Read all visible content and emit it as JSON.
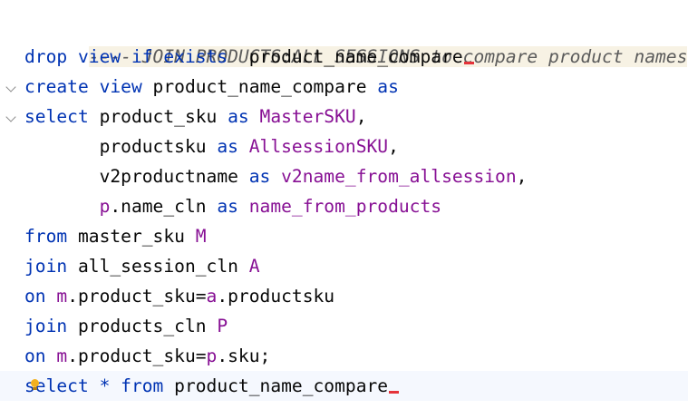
{
  "editor": {
    "lines": [
      {
        "tokens": [
          {
            "t": "comment",
            "v": "---- JOIN PRODUCTS:ALL_SESSIONS to compare product names"
          }
        ]
      },
      {
        "tokens": [
          {
            "t": "kw",
            "v": "drop view if exists"
          },
          {
            "t": "plain",
            "v": "  product_name_compare"
          }
        ]
      },
      {
        "tokens": [
          {
            "t": "kw",
            "v": "create view"
          },
          {
            "t": "plain",
            "v": " product_name_compare "
          },
          {
            "t": "kw",
            "v": "as"
          }
        ]
      },
      {
        "tokens": [
          {
            "t": "kw",
            "v": "select"
          },
          {
            "t": "plain",
            "v": " product_sku "
          },
          {
            "t": "kw",
            "v": "as"
          },
          {
            "t": "plain",
            "v": " "
          },
          {
            "t": "alias",
            "v": "MasterSKU"
          },
          {
            "t": "plain",
            "v": ","
          }
        ]
      },
      {
        "tokens": [
          {
            "t": "plain",
            "v": "       productsku "
          },
          {
            "t": "kw",
            "v": "as"
          },
          {
            "t": "plain",
            "v": " "
          },
          {
            "t": "alias",
            "v": "AllsessionSKU"
          },
          {
            "t": "plain",
            "v": ","
          }
        ]
      },
      {
        "tokens": [
          {
            "t": "plain",
            "v": "       v2productname "
          },
          {
            "t": "kw",
            "v": "as"
          },
          {
            "t": "plain",
            "v": " "
          },
          {
            "t": "alias",
            "v": "v2name_from_allsession"
          },
          {
            "t": "plain",
            "v": ","
          }
        ]
      },
      {
        "tokens": [
          {
            "t": "plain",
            "v": "       "
          },
          {
            "t": "alias",
            "v": "p"
          },
          {
            "t": "plain",
            "v": ".name_cln "
          },
          {
            "t": "kw",
            "v": "as"
          },
          {
            "t": "plain",
            "v": " "
          },
          {
            "t": "alias",
            "v": "name_from_products"
          }
        ]
      },
      {
        "tokens": [
          {
            "t": "kw",
            "v": "from"
          },
          {
            "t": "plain",
            "v": " master_sku "
          },
          {
            "t": "alias",
            "v": "M"
          }
        ]
      },
      {
        "tokens": [
          {
            "t": "kw",
            "v": "join"
          },
          {
            "t": "plain",
            "v": " all_session_cln "
          },
          {
            "t": "alias",
            "v": "A"
          }
        ]
      },
      {
        "tokens": [
          {
            "t": "kw",
            "v": "on"
          },
          {
            "t": "plain",
            "v": " "
          },
          {
            "t": "alias",
            "v": "m"
          },
          {
            "t": "plain",
            "v": ".product_sku="
          },
          {
            "t": "alias",
            "v": "a"
          },
          {
            "t": "plain",
            "v": ".productsku"
          }
        ]
      },
      {
        "tokens": [
          {
            "t": "kw",
            "v": "join"
          },
          {
            "t": "plain",
            "v": " products_cln "
          },
          {
            "t": "alias",
            "v": "P"
          }
        ]
      },
      {
        "tokens": [
          {
            "t": "kw",
            "v": "on"
          },
          {
            "t": "plain",
            "v": " "
          },
          {
            "t": "alias",
            "v": "m"
          },
          {
            "t": "plain",
            "v": ".product_sku="
          },
          {
            "t": "alias",
            "v": "p"
          },
          {
            "t": "plain",
            "v": ".sku;"
          }
        ]
      },
      {
        "tokens": [
          {
            "t": "kw",
            "v": "select"
          },
          {
            "t": "plain",
            "v": " "
          },
          {
            "t": "kw",
            "v": "*"
          },
          {
            "t": "plain",
            "v": " "
          },
          {
            "t": "kw",
            "v": "from"
          },
          {
            "t": "plain",
            "v": " product_name_compare"
          }
        ]
      }
    ],
    "fold_marker_lines": [
      2,
      3
    ],
    "error_marker_lines": [
      1,
      12
    ],
    "current_line": 12,
    "intention_icon": "lightbulb-icon",
    "colors": {
      "keyword": "#0033b3",
      "alias": "#871094",
      "comment": "#5b5b5b",
      "text": "#080808",
      "error": "#e5333a",
      "current_line_bg": "#f5f8fe"
    }
  }
}
